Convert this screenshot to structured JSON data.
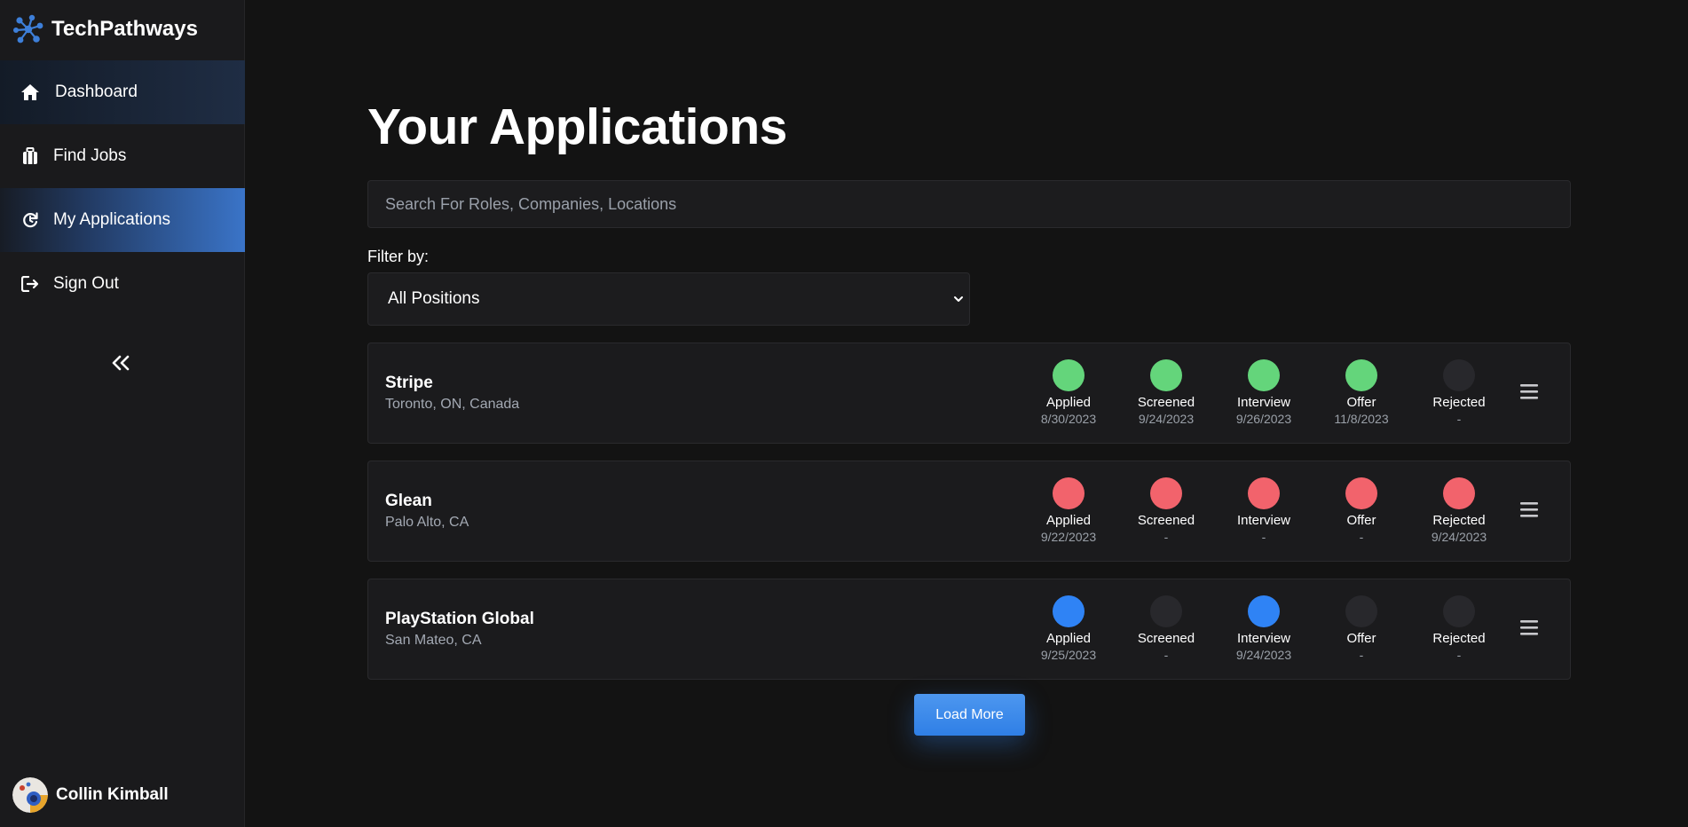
{
  "sidebar": {
    "brand": "TechPathways",
    "items": [
      {
        "label": "Dashboard",
        "icon": "home-icon"
      },
      {
        "label": "Find Jobs",
        "icon": "briefcase-icon"
      },
      {
        "label": "My Applications",
        "icon": "refresh-icon",
        "active": true
      },
      {
        "label": "Sign Out",
        "icon": "sign-out-icon"
      }
    ],
    "collapse": "«",
    "user": {
      "name": "Collin Kimball"
    }
  },
  "main": {
    "title": "Your Applications",
    "search_placeholder": "Search For Roles, Companies, Locations",
    "filter_label": "Filter by:",
    "filter_value": "All Positions",
    "load_more": "Load More"
  },
  "colors": {
    "green": "#64d57b",
    "red": "#f2636c",
    "blue": "#2f83f5",
    "inactive": "#28282c",
    "accent": "#3a74c8"
  },
  "applications": [
    {
      "company": "Stripe",
      "location": "Toronto, ON, Canada",
      "stages": [
        {
          "name": "Applied",
          "date": "8/30/2023",
          "status": "green"
        },
        {
          "name": "Screened",
          "date": "9/24/2023",
          "status": "green"
        },
        {
          "name": "Interview",
          "date": "9/26/2023",
          "status": "green"
        },
        {
          "name": "Offer",
          "date": "11/8/2023",
          "status": "green"
        },
        {
          "name": "Rejected",
          "date": "-",
          "status": "none"
        }
      ]
    },
    {
      "company": "Glean",
      "location": "Palo Alto, CA",
      "stages": [
        {
          "name": "Applied",
          "date": "9/22/2023",
          "status": "red"
        },
        {
          "name": "Screened",
          "date": "-",
          "status": "red"
        },
        {
          "name": "Interview",
          "date": "-",
          "status": "red"
        },
        {
          "name": "Offer",
          "date": "-",
          "status": "red"
        },
        {
          "name": "Rejected",
          "date": "9/24/2023",
          "status": "red"
        }
      ]
    },
    {
      "company": "PlayStation Global",
      "location": "San Mateo, CA",
      "stages": [
        {
          "name": "Applied",
          "date": "9/25/2023",
          "status": "blue"
        },
        {
          "name": "Screened",
          "date": "-",
          "status": "none"
        },
        {
          "name": "Interview",
          "date": "9/24/2023",
          "status": "blue"
        },
        {
          "name": "Offer",
          "date": "-",
          "status": "none"
        },
        {
          "name": "Rejected",
          "date": "-",
          "status": "none"
        }
      ]
    }
  ]
}
